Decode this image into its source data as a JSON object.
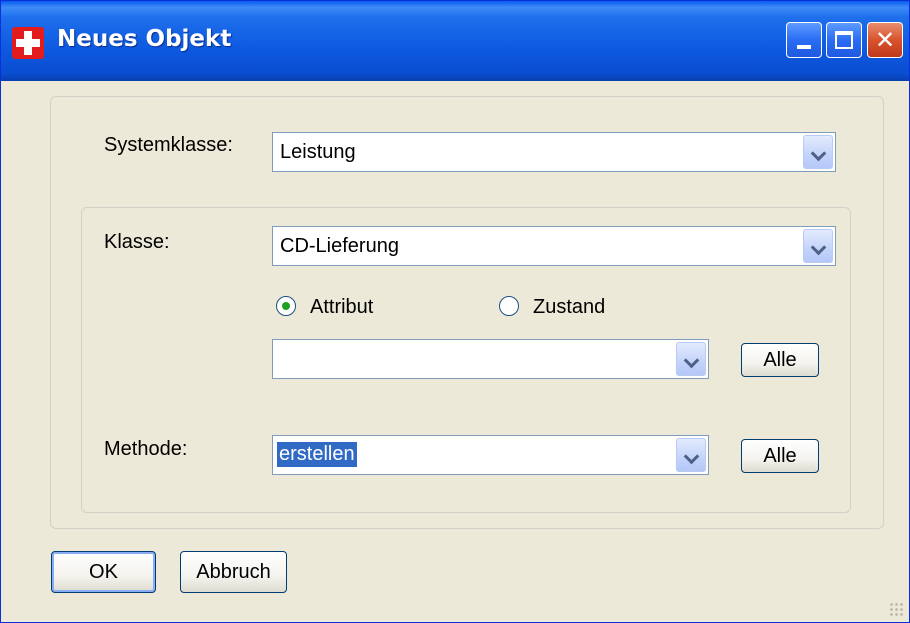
{
  "window": {
    "title": "Neues Objekt"
  },
  "form": {
    "systemklasse_label": "Systemklasse:",
    "systemklasse_value": "Leistung",
    "klasse_label": "Klasse:",
    "klasse_value": "CD-Lieferung",
    "radio_attribut_label": "Attribut",
    "radio_zustand_label": "Zustand",
    "radio_selected": "Attribut",
    "attribut_value": "",
    "alle_label_1": "Alle",
    "methode_label": "Methode:",
    "methode_value": "erstellen",
    "alle_label_2": "Alle"
  },
  "footer": {
    "ok_label": "OK",
    "cancel_label": "Abbruch"
  },
  "colors": {
    "titlebar": "#0a5bf0",
    "selection": "#316ac5",
    "dialog_bg": "#ece9d8"
  }
}
